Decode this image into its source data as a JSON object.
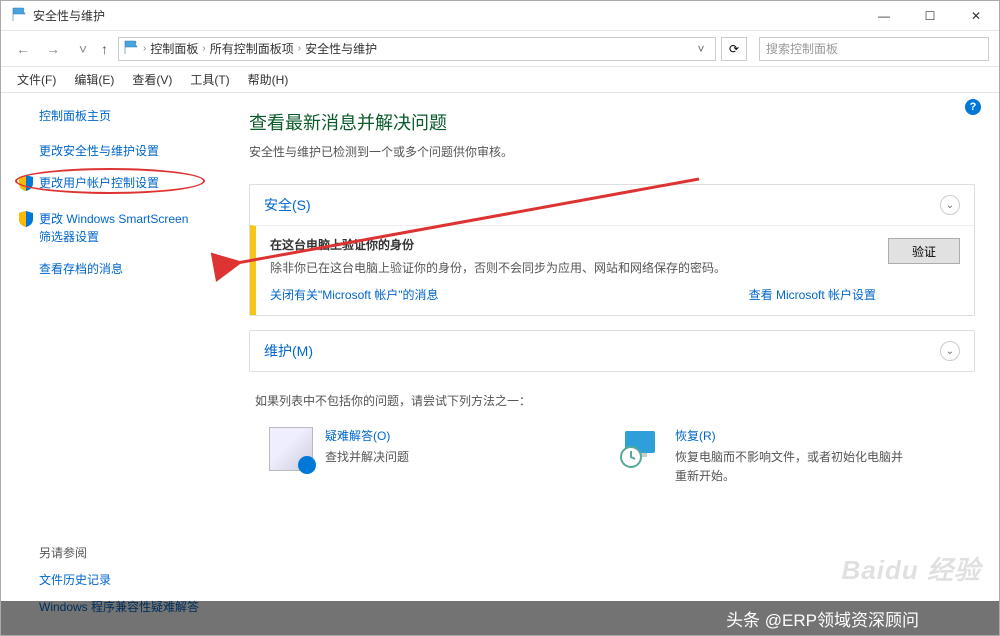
{
  "window": {
    "title": "安全性与维护",
    "controls": {
      "min": "—",
      "max": "☐",
      "close": "✕"
    }
  },
  "nav": {
    "back": "←",
    "forward": "→",
    "dropdown": "˅",
    "up": "↑",
    "breadcrumb": [
      "控制面板",
      "所有控制面板项",
      "安全性与维护"
    ],
    "refresh": "⟳"
  },
  "search": {
    "placeholder": "搜索控制面板"
  },
  "menu": [
    "文件(F)",
    "编辑(E)",
    "查看(V)",
    "工具(T)",
    "帮助(H)"
  ],
  "sidebar": {
    "home": "控制面板主页",
    "links": [
      {
        "label": "更改安全性与维护设置",
        "shield": false
      },
      {
        "label": "更改用户帐户控制设置",
        "shield": true,
        "highlight": true
      },
      {
        "label": "更改 Windows SmartScreen\n筛选器设置",
        "shield": true
      },
      {
        "label": "查看存档的消息",
        "shield": false
      }
    ],
    "seealso_heading": "另请参阅",
    "seealso": [
      "文件历史记录",
      "Windows 程序兼容性疑难解答"
    ]
  },
  "main": {
    "heading": "查看最新消息并解决问题",
    "subheading": "安全性与维护已检测到一个或多个问题供你审核。",
    "security": {
      "title": "安全(S)",
      "warn_title": "在这台电脑上验证你的身份",
      "warn_text": "除非你已在这台电脑上验证你的身份，否则不会同步为应用、网站和网络保存的密码。",
      "link1": "关闭有关\"Microsoft 帐户\"的消息",
      "link2": "查看 Microsoft 帐户设置",
      "verify_btn": "验证"
    },
    "maintenance": {
      "title": "维护(M)"
    },
    "fallback": "如果列表中不包括你的问题，请尝试下列方法之一：",
    "options": [
      {
        "title": "疑难解答(O)",
        "desc": "查找并解决问题"
      },
      {
        "title": "恢复(R)",
        "desc": "恢复电脑而不影响文件，或者初始化电脑并重新开始。"
      }
    ]
  },
  "watermark": "Baidu 经验",
  "caption": "头条 @ERP领域资深顾问"
}
